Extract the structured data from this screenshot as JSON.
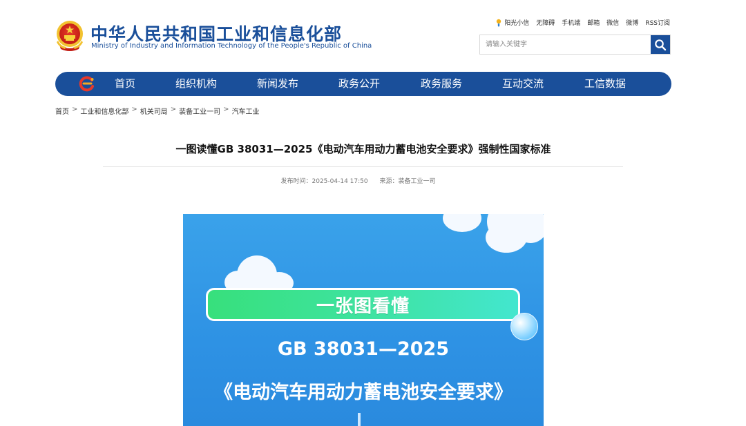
{
  "header": {
    "org_name_cn": "中华人民共和国工业和信息化部",
    "org_name_en": "Ministry of Industry and Information Technology of the People's Republic of China",
    "emblem_icon": "national-emblem-icon",
    "top_links": [
      "阳光小信",
      "无障碍",
      "手机端",
      "邮箱",
      "微信",
      "微博",
      "RSS订阅"
    ],
    "search_placeholder": "请输入关键字",
    "search_icon": "search-icon",
    "brand_color": "#1a4f9a"
  },
  "nav": {
    "logo_icon": "site-logo-icon",
    "items": [
      "首页",
      "组织机构",
      "新闻发布",
      "政务公开",
      "政务服务",
      "互动交流",
      "工信数据"
    ]
  },
  "breadcrumb": [
    "首页",
    "工业和信息化部",
    "机关司局",
    "装备工业一司",
    "汽车工业"
  ],
  "breadcrumb_separator": ">",
  "article": {
    "title": "一图读懂GB 38031—2025《电动汽车用动力蓄电池安全要求》强制性国家标准",
    "publish_time": "发布时间：2025-04-14 17:50",
    "source": "来源：装备工业一司"
  },
  "infographic": {
    "banner_text": "一张图看懂",
    "standard_code": "GB 38031—2025",
    "standard_name": "《电动汽车用动力蓄电池安全要求》"
  }
}
